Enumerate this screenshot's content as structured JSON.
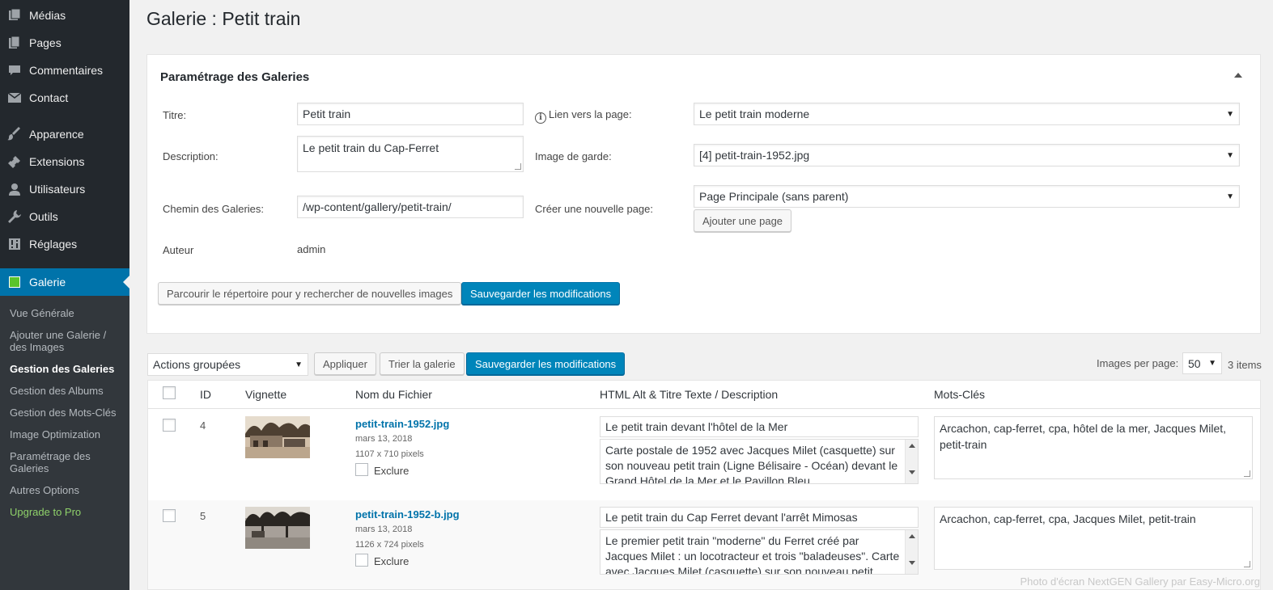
{
  "sidebar": {
    "items": [
      {
        "label": "Médias",
        "icon": "media-icon"
      },
      {
        "label": "Pages",
        "icon": "pages-icon"
      },
      {
        "label": "Commentaires",
        "icon": "comment-icon"
      },
      {
        "label": "Contact",
        "icon": "mail-icon"
      },
      {
        "label": "Apparence",
        "icon": "brush-icon"
      },
      {
        "label": "Extensions",
        "icon": "plugin-icon"
      },
      {
        "label": "Utilisateurs",
        "icon": "user-icon"
      },
      {
        "label": "Outils",
        "icon": "wrench-icon"
      },
      {
        "label": "Réglages",
        "icon": "settings-icon"
      },
      {
        "label": "Galerie",
        "icon": "gallery-icon"
      }
    ],
    "submenu": [
      "Vue Générale",
      "Ajouter une Galerie / des Images",
      "Gestion des Galeries",
      "Gestion des Albums",
      "Gestion des Mots-Clés",
      "Image Optimization",
      "Paramétrage des Galeries",
      "Autres Options",
      "Upgrade to Pro"
    ]
  },
  "page": {
    "title": "Galerie : Petit train"
  },
  "settings": {
    "title": "Paramétrage des Galeries",
    "title_label": "Titre:",
    "title_value": "Petit train",
    "desc_label": "Description:",
    "desc_value": "Le petit train du Cap-Ferret",
    "path_label": "Chemin des Galeries:",
    "path_value": "/wp-content/gallery/petit-train/",
    "author_label": "Auteur",
    "author_value": "admin",
    "link_label": "Lien vers la page:",
    "link_value": "Le petit train moderne",
    "cover_label": "Image de garde:",
    "cover_value": "[4] petit-train-1952.jpg",
    "newpage_label": "Créer une nouvelle page:",
    "newpage_value": "Page Principale (sans parent)",
    "add_page_button": "Ajouter une page",
    "scan_button": "Parcourir le répertoire pour y rechercher de nouvelles images",
    "save_button": "Sauvegarder les modifications"
  },
  "toolbar": {
    "bulk_actions": "Actions groupées",
    "apply": "Appliquer",
    "sort": "Trier la galerie",
    "save": "Sauvegarder les modifications",
    "per_page_label": "Images per page:",
    "per_page_value": "50",
    "items_count": "3 items"
  },
  "table": {
    "columns": [
      "ID",
      "Vignette",
      "Nom du Fichier",
      "HTML Alt & Titre Texte / Description",
      "Mots-Clés"
    ],
    "exclude_label": "Exclure",
    "rows": [
      {
        "id": "4",
        "filename": "petit-train-1952.jpg",
        "date": "mars 13, 2018",
        "size": "1107 x 710 pixels",
        "alt": "Le petit train devant l'hôtel de la Mer",
        "description": "Carte postale de 1952 avec Jacques Milet (casquette) sur son nouveau petit train (Ligne Bélisaire - Océan) devant le Grand Hôtel de la Mer et le Pavillon Bleu.",
        "tags": "Arcachon, cap-ferret, cpa, hôtel de la mer, Jacques Milet, petit-train"
      },
      {
        "id": "5",
        "filename": "petit-train-1952-b.jpg",
        "date": "mars 13, 2018",
        "size": "1126 x 724 pixels",
        "alt": "Le petit train du Cap Ferret devant l'arrêt Mimosas",
        "description": "Le premier petit train \"moderne\" du Ferret créé par Jacques Milet : un locotracteur et trois \"baladeuses\". Carte avec Jacques Milet (casquette) sur son nouveau petit",
        "tags": "Arcachon, cap-ferret, cpa, Jacques Milet, petit-train"
      }
    ]
  },
  "watermark": "Photo d'écran NextGEN Gallery par Easy-Micro.org",
  "colors": {
    "sidebar": "#23282d",
    "accent": "#0073aa",
    "primary_button": "#0085ba"
  }
}
